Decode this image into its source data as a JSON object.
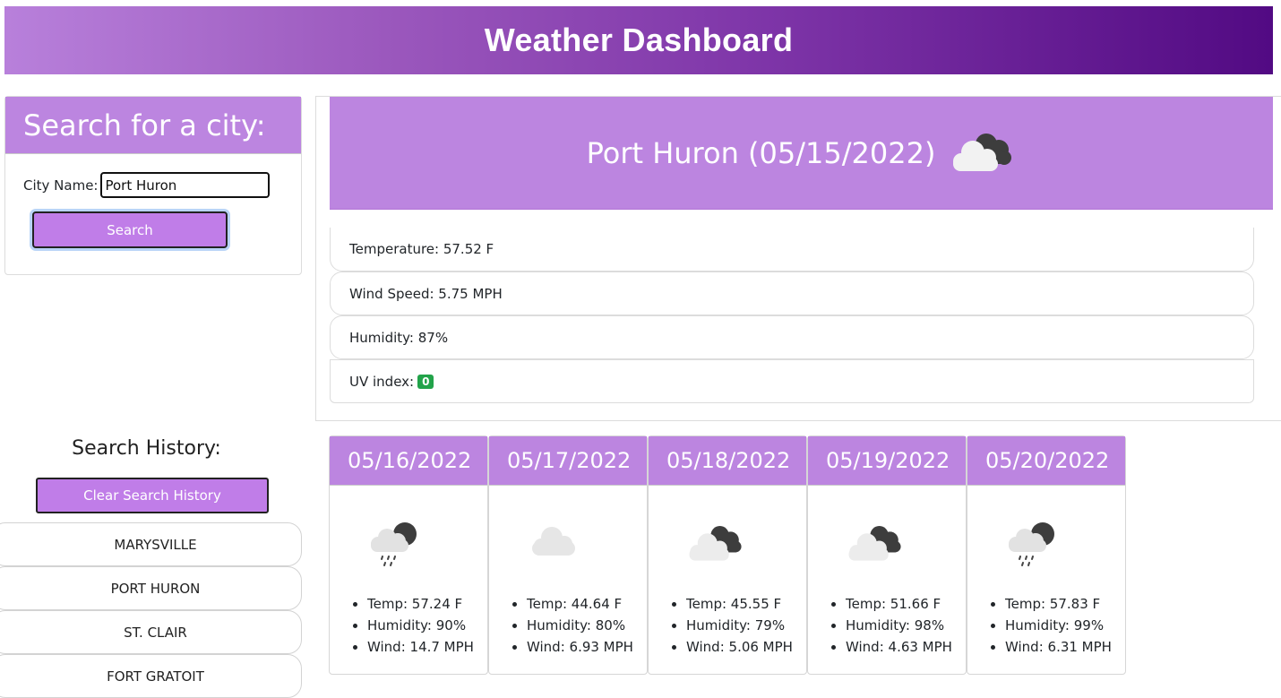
{
  "header": {
    "title": "Weather Dashboard"
  },
  "search": {
    "title": "Search for a city:",
    "label": "City Name:",
    "value": "Port Huron",
    "button": "Search"
  },
  "current": {
    "title": "Port Huron (05/15/2022)",
    "icon": "cloudy-icon",
    "temperature": "Temperature: 57.52 F",
    "wind": "Wind Speed: 5.75 MPH",
    "humidity": "Humidity: 87%",
    "uv_label": "UV index:",
    "uv_value": "0",
    "uv_color": "#22a34a"
  },
  "history": {
    "title": "Search History:",
    "clear_button": "Clear Search History",
    "items": [
      "MARYSVILLE",
      "PORT HURON",
      "ST. CLAIR",
      "FORT GRATOIT"
    ]
  },
  "forecast": [
    {
      "date": "05/16/2022",
      "icon": "rain-icon",
      "temp": "Temp: 57.24 F",
      "humidity": "Humidity: 90%",
      "wind": "Wind: 14.7 MPH"
    },
    {
      "date": "05/17/2022",
      "icon": "cloud-icon",
      "temp": "Temp: 44.64 F",
      "humidity": "Humidity: 80%",
      "wind": "Wind: 6.93 MPH"
    },
    {
      "date": "05/18/2022",
      "icon": "cloudy-icon",
      "temp": "Temp: 45.55 F",
      "humidity": "Humidity: 79%",
      "wind": "Wind: 5.06 MPH"
    },
    {
      "date": "05/19/2022",
      "icon": "cloudy-icon",
      "temp": "Temp: 51.66 F",
      "humidity": "Humidity: 98%",
      "wind": "Wind: 4.63 MPH"
    },
    {
      "date": "05/20/2022",
      "icon": "rain-icon",
      "temp": "Temp: 57.83 F",
      "humidity": "Humidity: 99%",
      "wind": "Wind: 6.31 MPH"
    }
  ],
  "colors": {
    "accent": "#bc85e0",
    "button": "#c07de8",
    "header_start": "#b880db",
    "header_end": "#520a83"
  }
}
